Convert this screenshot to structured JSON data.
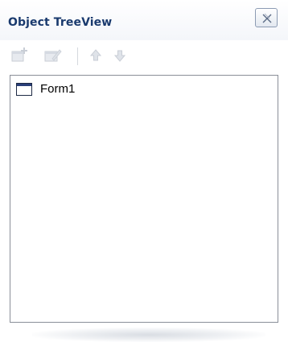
{
  "panel": {
    "title": "Object TreeView",
    "close_icon": "close-icon"
  },
  "toolbar": {
    "buttons": [
      {
        "icon": "add-item-icon",
        "enabled": false
      },
      {
        "icon": "edit-item-icon",
        "enabled": false
      },
      {
        "icon": "move-up-icon",
        "enabled": false
      },
      {
        "icon": "move-down-icon",
        "enabled": false
      }
    ]
  },
  "tree": {
    "items": [
      {
        "label": "Form1",
        "icon": "form-window-icon"
      }
    ]
  },
  "colors": {
    "title_text": "#1a3a6e",
    "tree_border": "#8a8f98",
    "disabled_icon": "#c9ced6"
  }
}
